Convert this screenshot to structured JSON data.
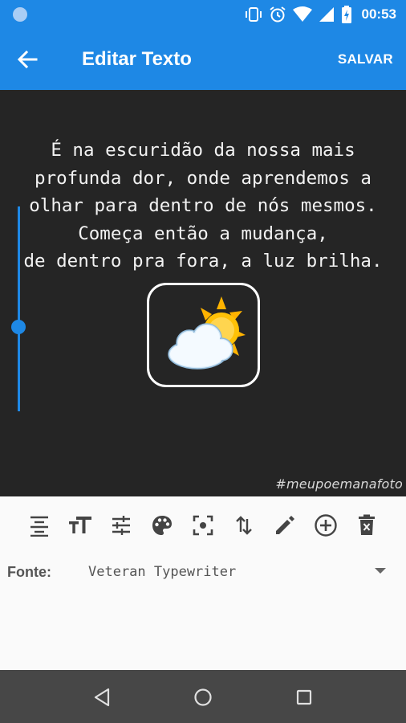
{
  "status_bar": {
    "time": "00:53",
    "icons": [
      "notification-dot-icon",
      "vibrate-icon",
      "alarm-icon",
      "wifi-icon",
      "signal-icon",
      "battery-charging-icon"
    ]
  },
  "app_bar": {
    "title": "Editar Texto",
    "save_label": "SALVAR",
    "back_icon": "arrow-left-icon"
  },
  "canvas": {
    "quote_lines": [
      "É na escuridão da nossa mais",
      "profunda dor, onde aprendemos a",
      "olhar para dentro de nós mesmos.",
      "Começa então a mudança,",
      "de dentro pra fora, a luz brilha."
    ],
    "emoji": "sun-behind-cloud",
    "watermark": "#meupoemanafoto",
    "background_color": "#252525",
    "text_color": "#f2f2f2",
    "size_slider_level": 0.55
  },
  "toolbar": {
    "tools": [
      "align-center-icon",
      "text-size-icon",
      "adjust-sliders-icon",
      "palette-icon",
      "center-focus-icon",
      "swap-vertical-icon",
      "pencil-icon",
      "add-circle-icon",
      "delete-icon"
    ]
  },
  "font": {
    "label": "Fonte:",
    "selected": "Veteran Typewriter"
  },
  "nav_bar": {
    "buttons": [
      "back-triangle-icon",
      "home-circle-icon",
      "recents-square-icon"
    ]
  },
  "colors": {
    "primary": "#1e88e5",
    "icon_gray": "#444444",
    "nav_bg": "#474747"
  }
}
